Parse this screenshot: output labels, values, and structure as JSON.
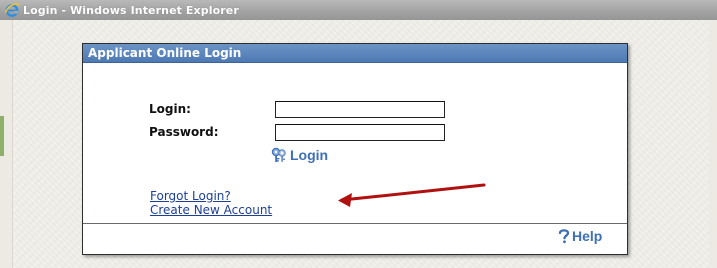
{
  "window": {
    "title": "Login - Windows Internet Explorer",
    "browser_icon": "internet-explorer-icon"
  },
  "panel": {
    "title": "Applicant Online Login",
    "header_color": "#5a84bb",
    "login_label": "Login:",
    "login_value": "",
    "password_label": "Password:",
    "password_value": "",
    "login_button": {
      "label": "Login",
      "icon": "keys-icon"
    },
    "links": {
      "forgot_login": "Forgot Login?",
      "create_account": "Create New Account"
    },
    "help_button": {
      "label": "Help",
      "icon": "question-mark-icon"
    }
  },
  "annotation": {
    "icon": "red-arrow-icon",
    "color": "#b01010"
  }
}
